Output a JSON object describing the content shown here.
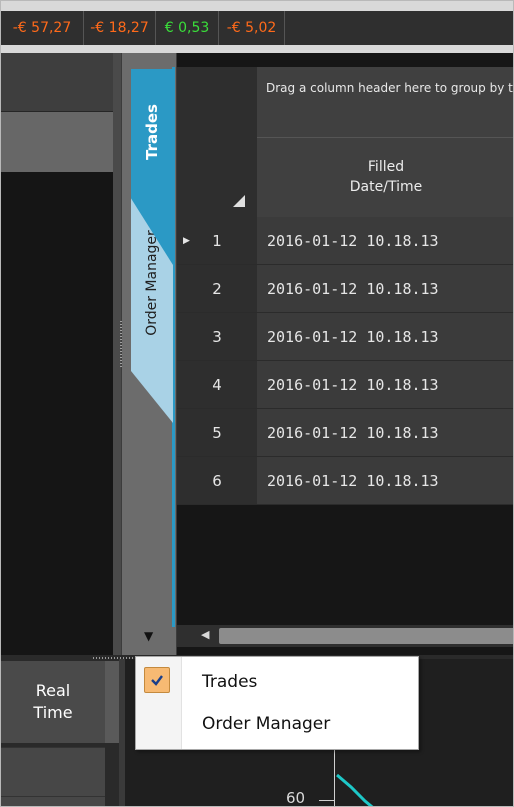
{
  "pnl_strip": {
    "values": [
      {
        "text": "-€ 57,27",
        "color": "#ff6a1a"
      },
      {
        "text": "-€ 18,27",
        "color": "#ff6a1a"
      },
      {
        "text": "€ 0,53",
        "color": "#3adf3a"
      },
      {
        "text": "-€ 5,02",
        "color": "#ff6a1a"
      }
    ]
  },
  "side_tabs": {
    "trades": "Trades",
    "order_manager": "Order Manager",
    "accent_color": "#2b99c5"
  },
  "grid": {
    "group_panel_hint": "Drag a column header here to group by that column",
    "column_header": "Filled\nDate/Time",
    "rows": [
      {
        "index": "1",
        "filled": "2016-01-12 10.18.13"
      },
      {
        "index": "2",
        "filled": "2016-01-12 10.18.13"
      },
      {
        "index": "3",
        "filled": "2016-01-12 10.18.13"
      },
      {
        "index": "4",
        "filled": "2016-01-12 10.18.13"
      },
      {
        "index": "5",
        "filled": "2016-01-12 10.18.13"
      },
      {
        "index": "6",
        "filled": "2016-01-12 10.18.13"
      }
    ]
  },
  "lower_panel": {
    "real_time_label": "Real\nTime",
    "chart_tick_label": "60"
  },
  "context_menu": {
    "items": [
      {
        "label": "Trades",
        "checked": true
      },
      {
        "label": "Order Manager",
        "checked": false
      }
    ]
  },
  "icons": {
    "checkmark": "check-icon",
    "row_pointer": "row-pointer-icon",
    "sort": "sort-triangle-icon",
    "dropdown": "caret-down-icon",
    "scroll_left": "scroll-left-arrow-icon"
  }
}
